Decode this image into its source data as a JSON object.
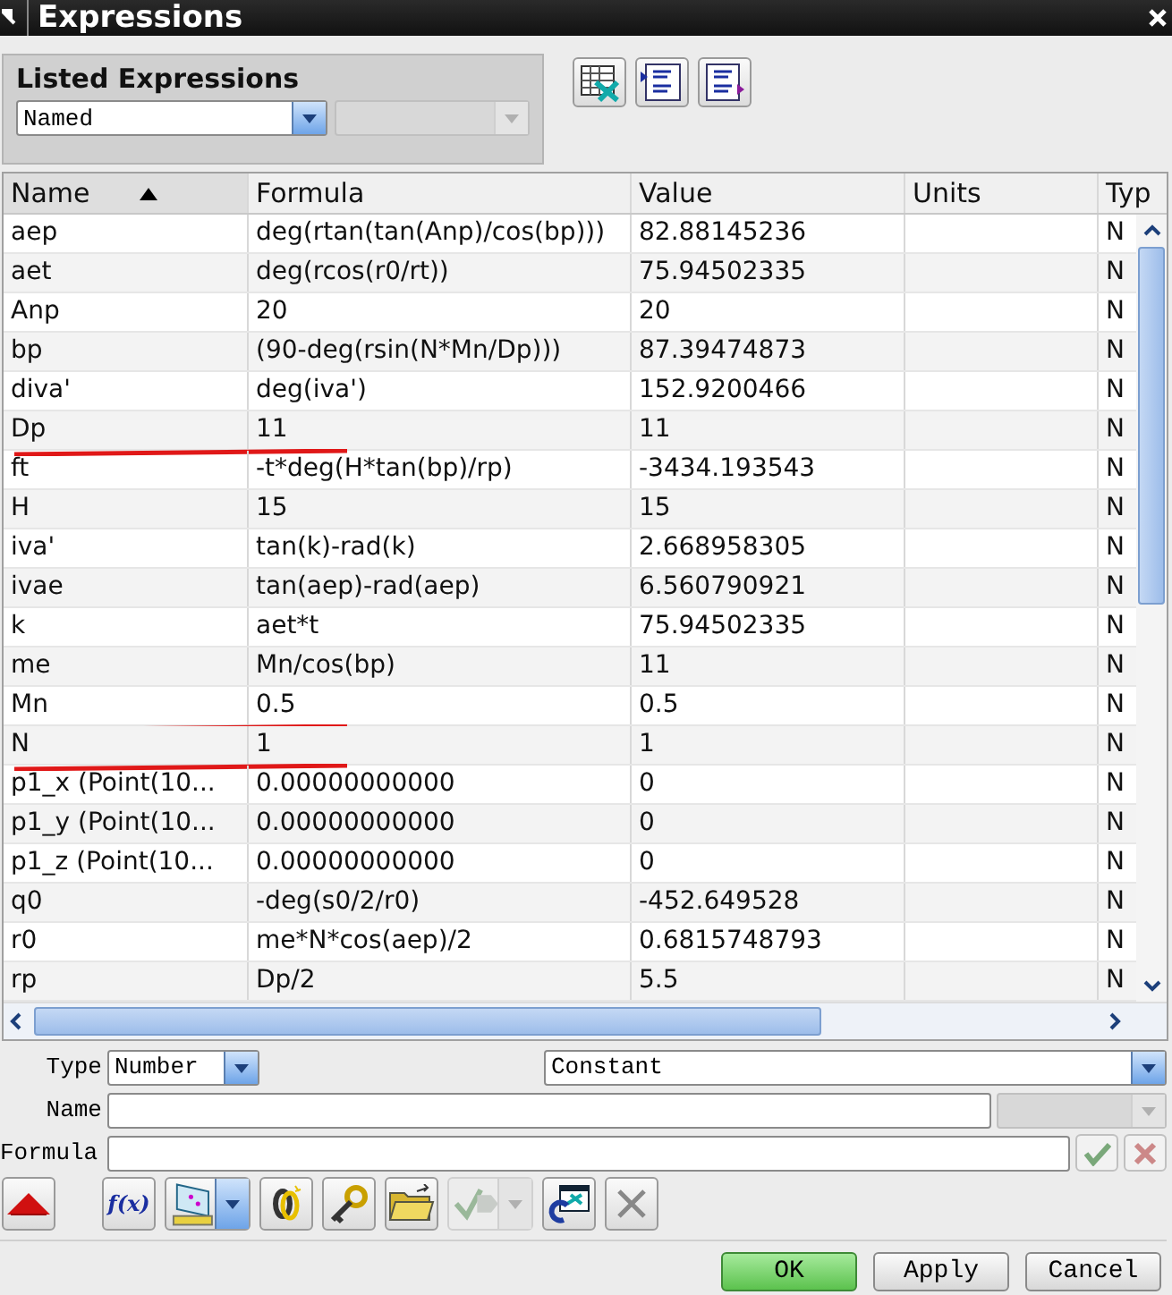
{
  "window": {
    "title": "Expressions"
  },
  "listed_expressions": {
    "label": "Listed Expressions",
    "filter": {
      "value": "Named"
    },
    "secondary_filter": {
      "disabled": true
    }
  },
  "table": {
    "columns": [
      {
        "label": "Name",
        "sorted": true
      },
      {
        "label": "Formula",
        "sorted": false
      },
      {
        "label": "Value",
        "sorted": false
      },
      {
        "label": "Units",
        "sorted": false
      },
      {
        "label": "Typ",
        "sorted": false
      }
    ],
    "rows": [
      {
        "name": "aep",
        "formula": "deg(rtan(tan(Anp)/cos(bp)))",
        "value": "82.88145236",
        "type": "N",
        "marked": false
      },
      {
        "name": "aet",
        "formula": "deg(rcos(r0/rt))",
        "value": "75.94502335",
        "type": "N",
        "marked": false
      },
      {
        "name": "Anp",
        "formula": "20",
        "value": "20",
        "type": "N",
        "marked": false
      },
      {
        "name": "bp",
        "formula": "(90-deg(rsin(N*Mn/Dp)))",
        "value": "87.39474873",
        "type": "N",
        "marked": false
      },
      {
        "name": "diva'",
        "formula": "deg(iva')",
        "value": "152.9200466",
        "type": "N",
        "marked": false
      },
      {
        "name": "Dp",
        "formula": "11",
        "value": "11",
        "type": "N",
        "marked": true
      },
      {
        "name": "ft",
        "formula": "-t*deg(H*tan(bp)/rp)",
        "value": "-3434.193543",
        "type": "N",
        "marked": false
      },
      {
        "name": "H",
        "formula": "15",
        "value": "15",
        "type": "N",
        "marked": false
      },
      {
        "name": "iva'",
        "formula": "tan(k)-rad(k)",
        "value": "2.668958305",
        "type": "N",
        "marked": false
      },
      {
        "name": "ivae",
        "formula": "tan(aep)-rad(aep)",
        "value": "6.560790921",
        "type": "N",
        "marked": false
      },
      {
        "name": "k",
        "formula": "aet*t",
        "value": "75.94502335",
        "type": "N",
        "marked": false
      },
      {
        "name": "me",
        "formula": "Mn/cos(bp)",
        "value": "11",
        "type": "N",
        "marked": false
      },
      {
        "name": "Mn",
        "formula": "0.5",
        "value": "0.5",
        "type": "N",
        "marked": true
      },
      {
        "name": "N",
        "formula": "1",
        "value": "1",
        "type": "N",
        "marked": true
      },
      {
        "name": "p1_x  (Point(10...",
        "formula": "0.00000000000",
        "value": "0",
        "type": "N",
        "marked": false
      },
      {
        "name": "p1_y  (Point(10...",
        "formula": "0.00000000000",
        "value": "0",
        "type": "N",
        "marked": false
      },
      {
        "name": "p1_z  (Point(10...",
        "formula": "0.00000000000",
        "value": "0",
        "type": "N",
        "marked": false
      },
      {
        "name": "q0",
        "formula": "-deg(s0/2/r0)",
        "value": "-452.649528",
        "type": "N",
        "marked": false
      },
      {
        "name": "r0",
        "formula": "me*N*cos(aep)/2",
        "value": "0.6815748793",
        "type": "N",
        "marked": false
      },
      {
        "name": "rp",
        "formula": "Dp/2",
        "value": "5.5",
        "type": "N",
        "marked": false
      }
    ]
  },
  "editor": {
    "type_label": "Type",
    "type_value": "Number",
    "subtype_value": "Constant",
    "name_label": "Name",
    "formula_label": "Formula",
    "function_button": "f(x)"
  },
  "buttons": [
    {
      "label": "OK",
      "default": true
    },
    {
      "label": "Apply",
      "default": false
    },
    {
      "label": "Cancel",
      "default": false
    }
  ]
}
